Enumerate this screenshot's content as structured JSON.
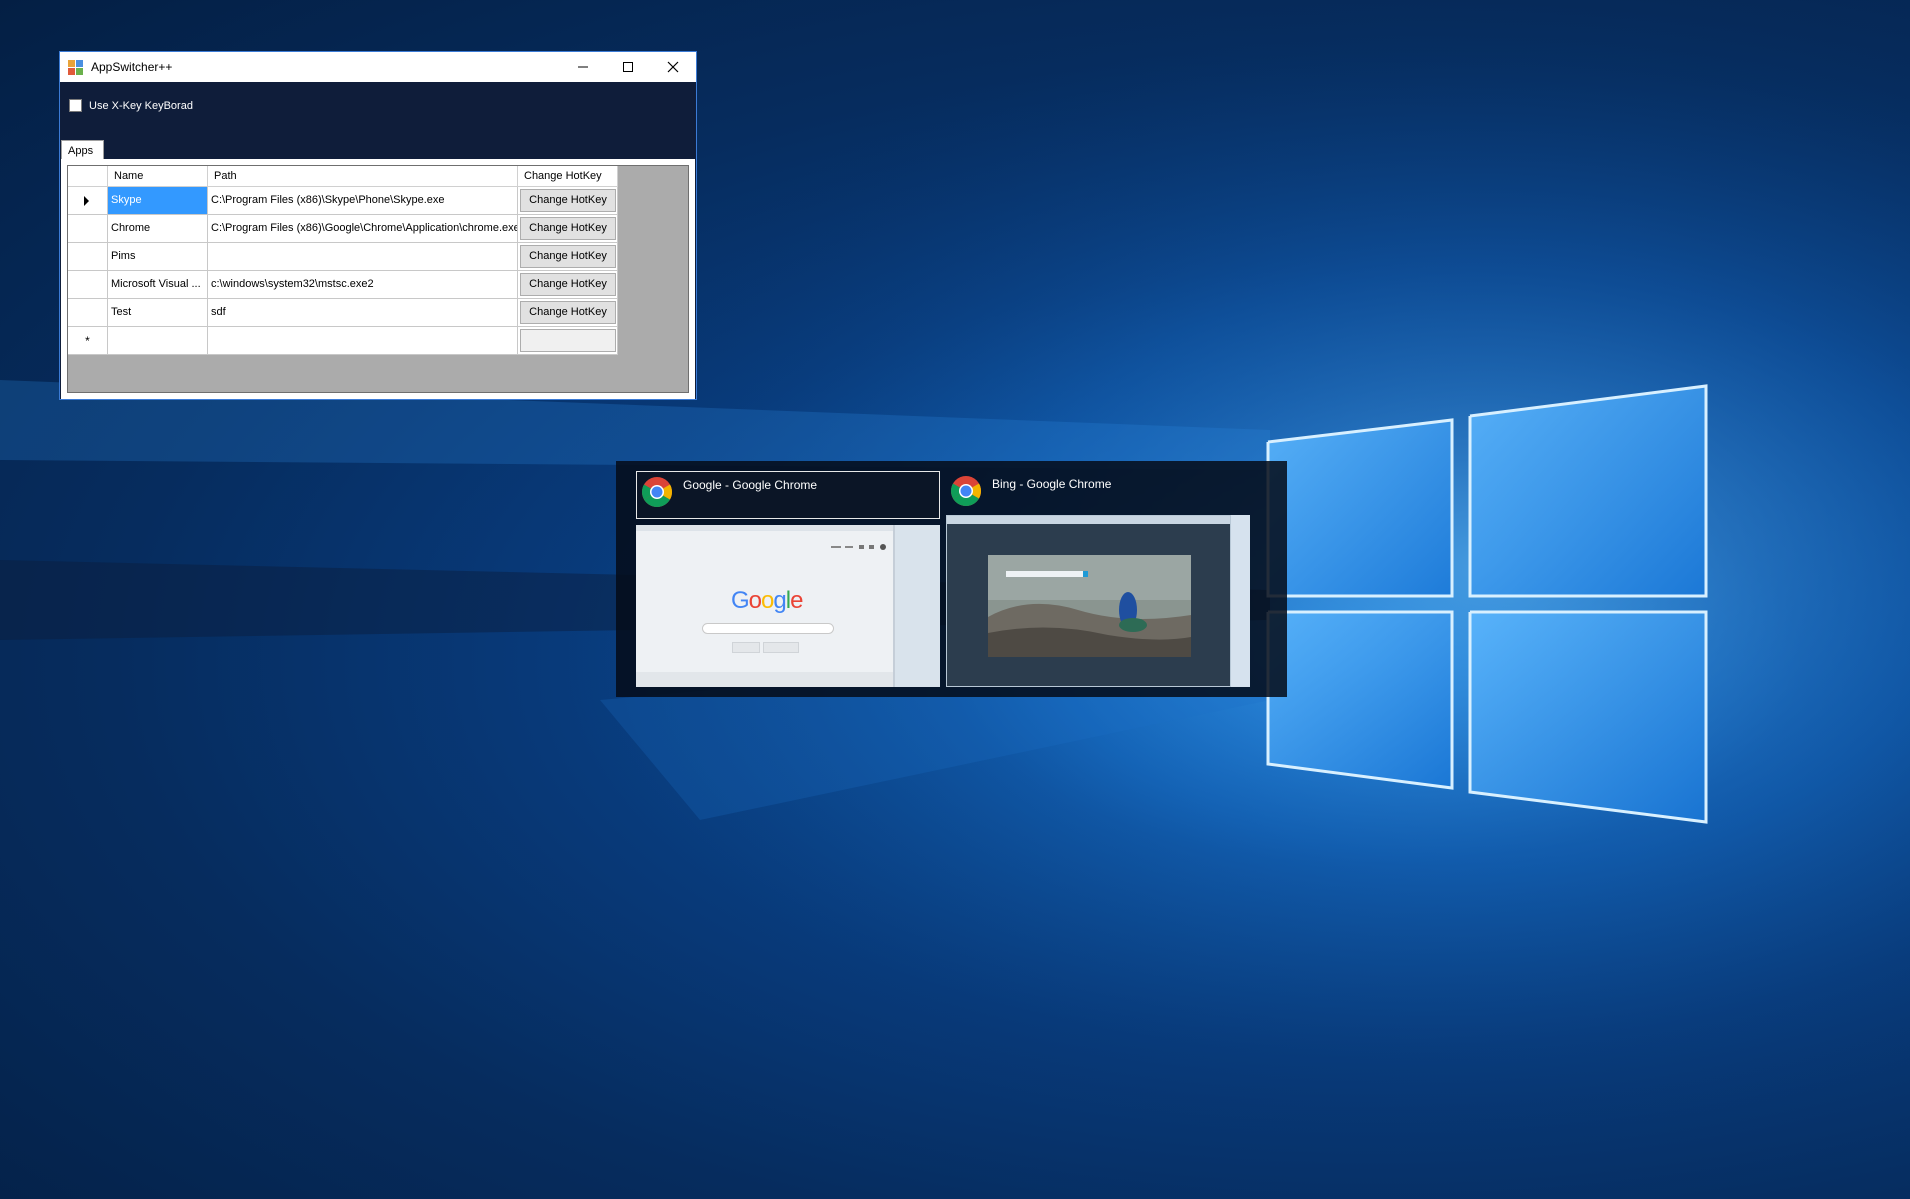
{
  "window": {
    "title": "AppSwitcher++",
    "xkey_checkbox_label": "Use X-Key KeyBorad",
    "xkey_checked": false,
    "tab_label": "Apps"
  },
  "grid": {
    "headers": [
      "Name",
      "Path",
      "Change HotKey"
    ],
    "rows": [
      {
        "name": "Skype",
        "path": "C:\\Program Files (x86)\\Skype\\Phone\\Skype.exe",
        "button": "Change HotKey",
        "selected": true
      },
      {
        "name": "Chrome",
        "path": "C:\\Program Files (x86)\\Google\\Chrome\\Application\\chrome.exe",
        "button": "Change HotKey"
      },
      {
        "name": "Pims",
        "path": "",
        "button": "Change HotKey"
      },
      {
        "name": "Microsoft Visual ...",
        "path": "c:\\windows\\system32\\mstsc.exe2",
        "button": "Change HotKey"
      },
      {
        "name": "Test",
        "path": "sdf",
        "button": "Change HotKey"
      }
    ],
    "new_row_marker": "*"
  },
  "switcher": {
    "items": [
      {
        "title": "Google - Google Chrome",
        "icon": "chrome-icon",
        "active": true
      },
      {
        "title": "Bing - Google Chrome",
        "icon": "chrome-icon",
        "active": false
      }
    ],
    "google_thumb_logo": "Google"
  },
  "colors": {
    "selection": "#3399ff",
    "window_body": "#0f1d3a",
    "wallpaper": "#0a4a9a"
  }
}
